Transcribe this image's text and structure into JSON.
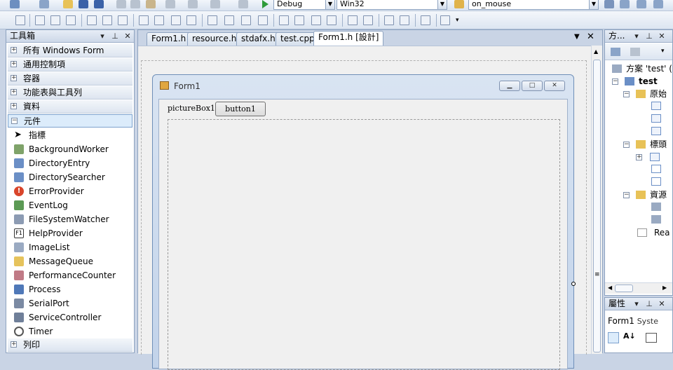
{
  "toolbar": {
    "config": "Debug",
    "platform": "Win32",
    "find": "on_mouse"
  },
  "toolbox": {
    "title": "工具箱",
    "categories_top": [
      "所有 Windows Form",
      "通用控制項",
      "容器",
      "功能表與工具列",
      "資料"
    ],
    "expanded": "元件",
    "items": [
      "指標",
      "BackgroundWorker",
      "DirectoryEntry",
      "DirectorySearcher",
      "ErrorProvider",
      "EventLog",
      "FileSystemWatcher",
      "HelpProvider",
      "ImageList",
      "MessageQueue",
      "PerformanceCounter",
      "Process",
      "SerialPort",
      "ServiceController",
      "Timer"
    ],
    "after": "列印"
  },
  "tabs": [
    "Form1.h",
    "resource.h",
    "stdafx.h",
    "test.cpp",
    "Form1.h [設計]"
  ],
  "form": {
    "title": "Form1",
    "picturebox_label": "pictureBox1",
    "button_label": "button1"
  },
  "solution": {
    "title": "方...",
    "root": "方案 'test' (",
    "project": "test",
    "nodes": [
      "原始",
      "標頭",
      "資源",
      "Rea"
    ]
  },
  "properties": {
    "title": "屬性",
    "object": "Form1",
    "type": "Syste"
  }
}
